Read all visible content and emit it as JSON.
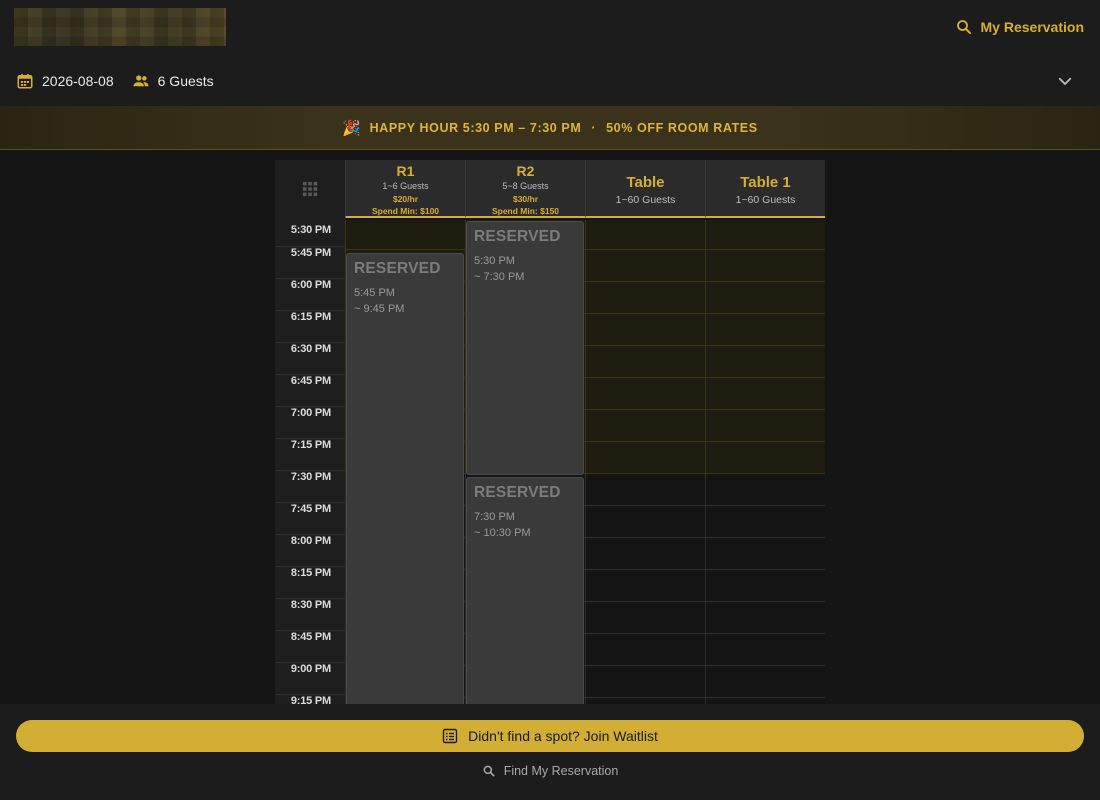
{
  "header": {
    "my_reservation_label": "My Reservation"
  },
  "filters": {
    "date": "2026-08-08",
    "guests": "6 Guests"
  },
  "banner": {
    "emoji": "🎉",
    "happy_hour": "HAPPY HOUR 5:30 PM – 7:30 PM",
    "separator": "·",
    "offer": "50% OFF ROOM RATES"
  },
  "columns": [
    {
      "name": "R1",
      "capacity": "1~6 Guests",
      "rate": "$20/hr",
      "min_spend": "Spend Min: $100"
    },
    {
      "name": "R2",
      "capacity": "5~8 Guests",
      "rate": "$30/hr",
      "min_spend": "Spend Min: $150"
    },
    {
      "name": "Table",
      "capacity": "1~60 Guests"
    },
    {
      "name": "Table 1",
      "capacity": "1~60 Guests"
    }
  ],
  "time_slots": [
    "5:30 PM",
    "5:45 PM",
    "6:00 PM",
    "6:15 PM",
    "6:30 PM",
    "6:45 PM",
    "7:00 PM",
    "7:15 PM",
    "7:30 PM",
    "7:45 PM",
    "8:00 PM",
    "8:15 PM",
    "8:30 PM",
    "8:45 PM",
    "9:00 PM",
    "9:15 PM"
  ],
  "reservations": [
    {
      "title": "RESERVED",
      "start": "5:45 PM",
      "end": "~ 9:45 PM"
    },
    {
      "title": "RESERVED",
      "start": "5:30 PM",
      "end": "~ 7:30 PM"
    },
    {
      "title": "RESERVED",
      "start": "7:30 PM",
      "end": "~ 10:30 PM"
    }
  ],
  "footer": {
    "waitlist_label": "Didn't find a spot? Join Waitlist",
    "find_label": "Find My Reservation"
  },
  "colors": {
    "accent": "#d8ae35",
    "background": "#151515",
    "reserved_block": "#3a3a3a"
  },
  "icons": [
    "search-icon",
    "calendar-icon",
    "people-icon",
    "chevron-down-icon",
    "grid-icon",
    "list-icon"
  ]
}
